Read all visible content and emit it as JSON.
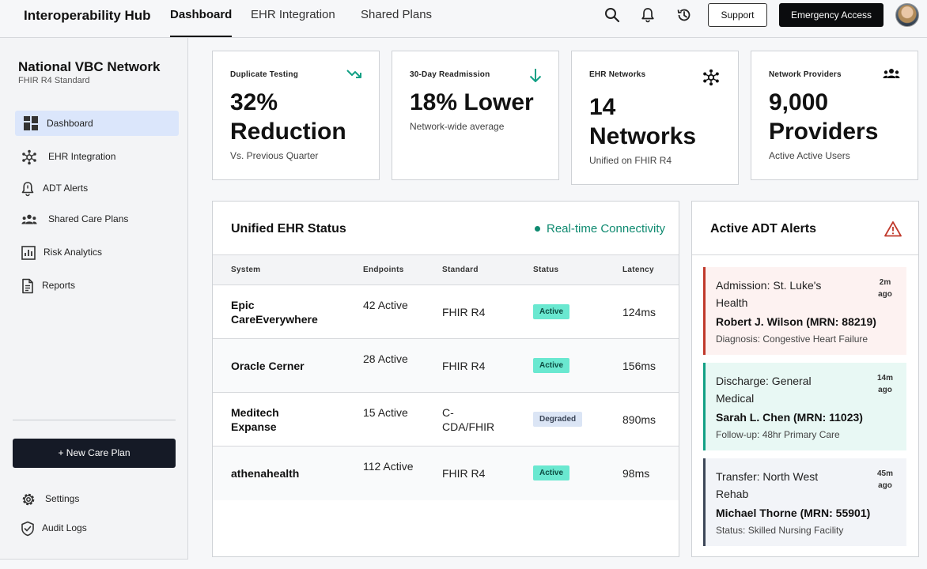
{
  "header": {
    "app_title": "Interoperability Hub",
    "tabs": [
      {
        "label": "Dashboard",
        "active": true
      },
      {
        "label": "EHR Integration",
        "active": false
      },
      {
        "label": "Shared Plans",
        "active": false
      }
    ],
    "support_label": "Support",
    "emergency_label": "Emergency Access",
    "icons": [
      "search-icon",
      "bell-icon",
      "history-icon"
    ]
  },
  "sidebar": {
    "org_name": "National VBC Network",
    "org_sub": "FHIR R4 Standard",
    "items": [
      {
        "label": "Dashboard",
        "icon": "grid-icon",
        "active": true
      },
      {
        "label": "EHR Integration",
        "icon": "network-icon",
        "active": false
      },
      {
        "label": "ADT Alerts",
        "icon": "bell-icon",
        "active": false
      },
      {
        "label": "Shared Care Plans",
        "icon": "people-icon",
        "active": false
      },
      {
        "label": "Risk Analytics",
        "icon": "chart-icon",
        "active": false
      },
      {
        "label": "Reports",
        "icon": "document-icon",
        "active": false
      }
    ],
    "new_plan_label": "+ New Care Plan",
    "footer_items": [
      {
        "label": "Settings",
        "icon": "gear-icon"
      },
      {
        "label": "Audit Logs",
        "icon": "shield-icon"
      }
    ]
  },
  "kpis": [
    {
      "label": "Duplicate Testing",
      "value_line1": "32%",
      "value_line2": "Reduction",
      "sub": "Vs. Previous Quarter",
      "icon": "trend-down-icon"
    },
    {
      "label": "30-Day Readmission",
      "value_line1": "18% Lower",
      "value_line2": "",
      "sub": "Network-wide average",
      "icon": "arrow-down-icon"
    },
    {
      "label": "EHR Networks",
      "value_line1": "14",
      "value_line2": "Networks",
      "sub": "Unified on FHIR R4",
      "icon": "network-icon"
    },
    {
      "label": "Network Providers",
      "value_line1": "9,000",
      "value_line2": "Providers",
      "sub": "Active Active Users",
      "icon": "people-icon"
    }
  ],
  "ehr_status": {
    "title": "Unified EHR Status",
    "realtime_label": "Real-time Connectivity",
    "columns": [
      "System",
      "Endpoints",
      "Standard",
      "Status",
      "Latency"
    ],
    "rows": [
      {
        "system": "Epic CareEverywhere",
        "endpoints": "42 Active",
        "standard": "FHIR R4",
        "status": "Active",
        "latency": "124ms"
      },
      {
        "system": "Oracle Cerner",
        "endpoints": "28 Active",
        "standard": "FHIR R4",
        "status": "Active",
        "latency": "156ms"
      },
      {
        "system": "Meditech Expanse",
        "endpoints": "15 Active",
        "standard": "C-CDA/FHIR",
        "status": "Degraded",
        "latency": "890ms"
      },
      {
        "system": "athenahealth",
        "endpoints": "112 Active",
        "standard": "FHIR R4",
        "status": "Active",
        "latency": "98ms"
      }
    ]
  },
  "adt_alerts": {
    "title": "Active ADT Alerts",
    "alerts": [
      {
        "title": "Admission: St. Luke's Health",
        "time": "2m ago",
        "patient": "Robert J. Wilson (MRN: 88219)",
        "detail": "Diagnosis: Congestive Heart Failure",
        "accent": "#c0392b",
        "bg": "#fdf2f1"
      },
      {
        "title": "Discharge: General Medical",
        "time": "14m ago",
        "patient": "Sarah L. Chen (MRN: 11023)",
        "detail": "Follow-up: 48hr Primary Care",
        "accent": "#12a085",
        "bg": "#e8f8f4"
      },
      {
        "title": "Transfer: North West Rehab",
        "time": "45m ago",
        "patient": "Michael Thorne (MRN: 55901)",
        "detail": "Status: Skilled Nursing Facility",
        "accent": "#3d4758",
        "bg": "#f2f4f8"
      }
    ]
  }
}
